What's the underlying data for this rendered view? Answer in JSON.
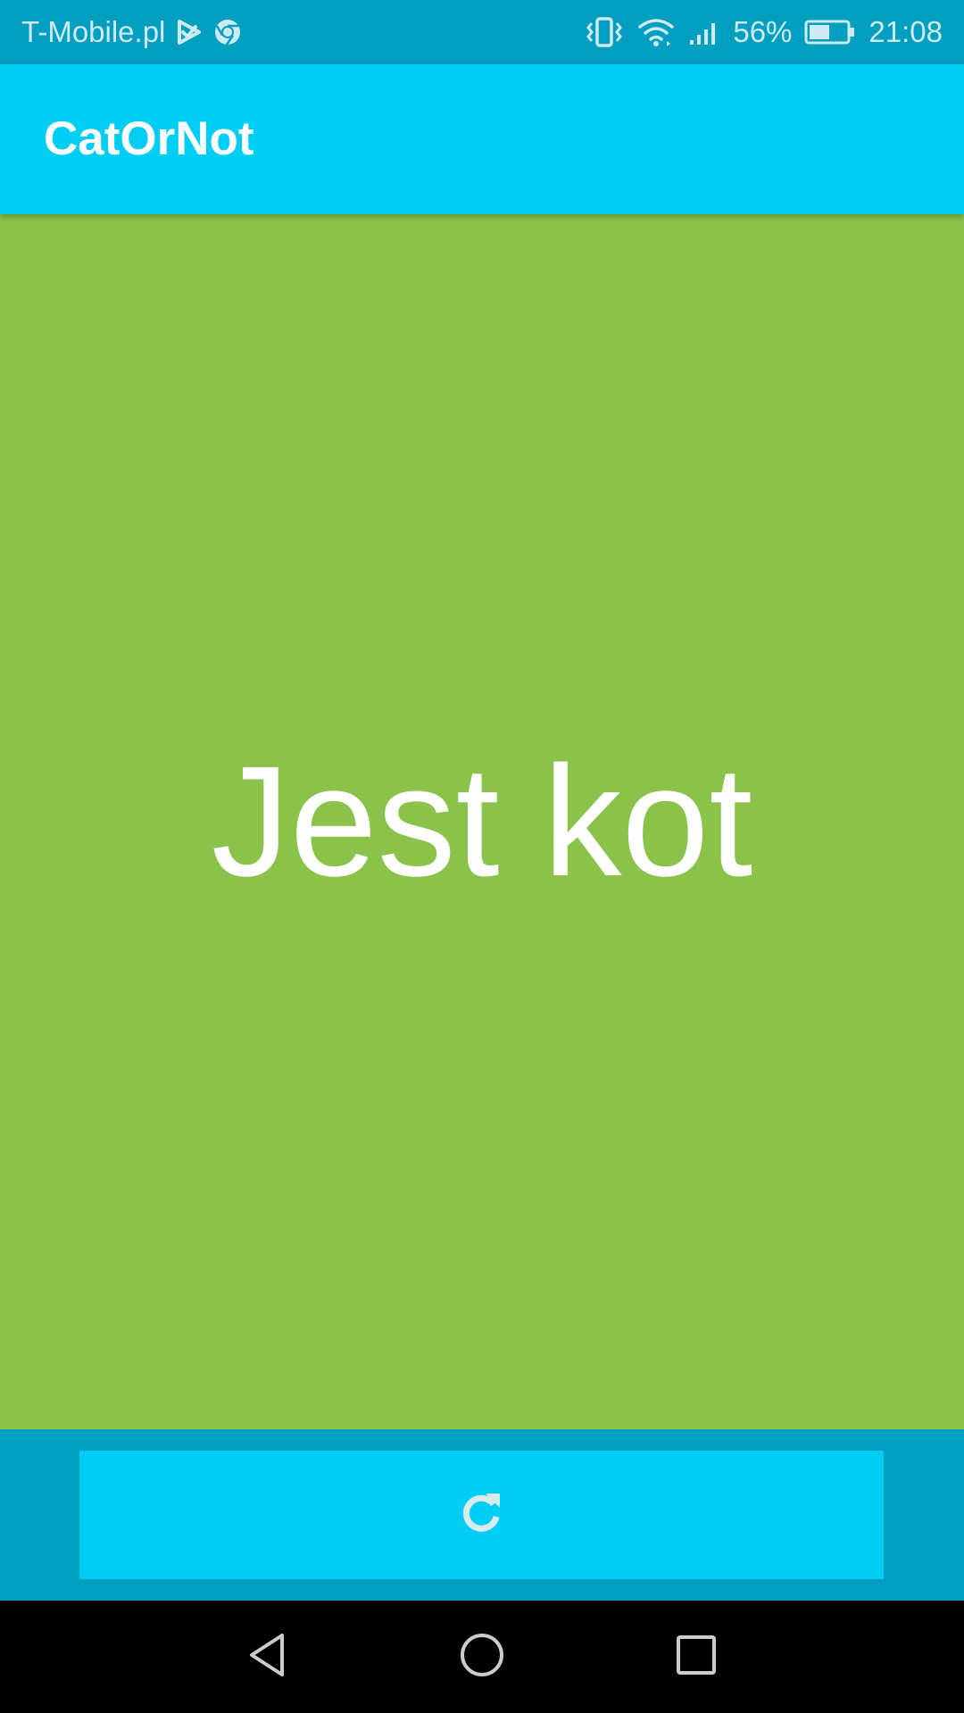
{
  "status_bar": {
    "carrier": "T-Mobile.pl",
    "battery_percent": "56%",
    "time": "21:08",
    "battery_level": 0.56,
    "icons": [
      "play-check-icon",
      "chrome-icon",
      "vibrate-icon",
      "wifi-icon",
      "signal-icon",
      "battery-icon"
    ]
  },
  "app_bar": {
    "title": "CatOrNot",
    "color": "#00cdf4"
  },
  "result": {
    "text": "Jest kot",
    "color": "#8bc34a"
  },
  "actions": {
    "refresh_icon": "refresh-icon",
    "button_color": "#00cdf4"
  },
  "navigation_bar": {
    "icons": [
      "back-icon",
      "home-icon",
      "recents-icon"
    ]
  },
  "colors": {
    "primary": "#00cdf4",
    "primary_dark": "#009ebf",
    "success_green": "#8bc34a"
  }
}
